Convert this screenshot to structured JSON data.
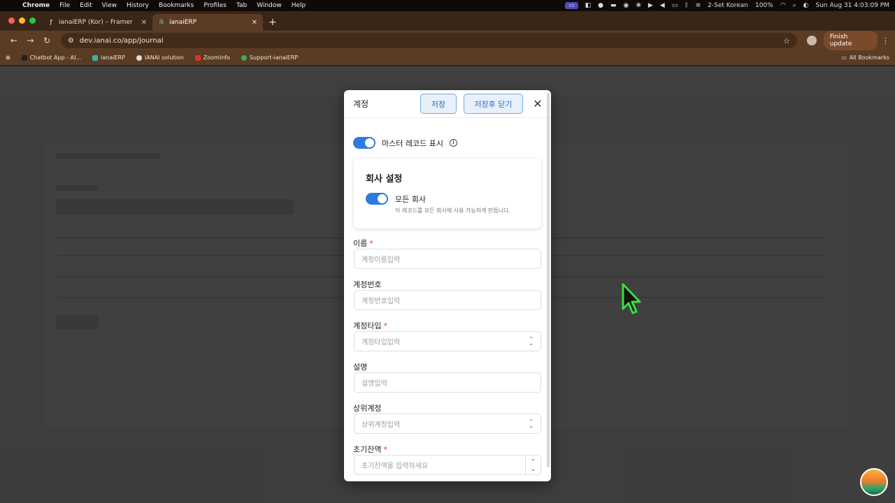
{
  "menubar": {
    "app": "Chrome",
    "items": [
      "File",
      "Edit",
      "View",
      "History",
      "Bookmarks",
      "Profiles",
      "Tab",
      "Window",
      "Help"
    ],
    "input_source": "2-Set Korean",
    "battery": "100%",
    "datetime": "Sun Aug 31  4:03:09 PM"
  },
  "tabs": [
    {
      "label": "ianaiERP (Kor) – Framer",
      "icon": "framer-icon",
      "active": false
    },
    {
      "label": "ianaiERP",
      "icon": "ianai-icon",
      "active": true
    }
  ],
  "toolbar": {
    "url": "dev.ianai.co/app/journal",
    "finish_update": "Finish update"
  },
  "bookmarks": {
    "items": [
      "Chatbot App - AI...",
      "ianaiERP",
      "IANAI solution",
      "ZoomInfo",
      "Support-ianaiERP"
    ],
    "all": "All Bookmarks"
  },
  "modal": {
    "title": "계정",
    "save": "저장",
    "save_close": "저장후 닫기",
    "master_record": "마스터 레코드 표시",
    "company": {
      "title": "회사 설정",
      "all_label": "모든 회사",
      "hint": "이 레코드를 모든 회사에 사용 가능하게 만듭니다."
    },
    "fields": {
      "name": {
        "label": "이름",
        "placeholder": "계정이름입력"
      },
      "number": {
        "label": "계정번호",
        "placeholder": "계정번호입력"
      },
      "type": {
        "label": "계정타입",
        "placeholder": "계정타입입력"
      },
      "description": {
        "label": "설명",
        "placeholder": "설명입력"
      },
      "parent": {
        "label": "상위계정",
        "placeholder": "상위계정입력"
      },
      "opening": {
        "label": "초기잔액",
        "placeholder": "초기잔액을 입력하세요"
      }
    },
    "required_mark": "*"
  },
  "colors": {
    "accent": "#2f7ae0",
    "required": "#e03535",
    "overlay": "#0a0a0c"
  }
}
